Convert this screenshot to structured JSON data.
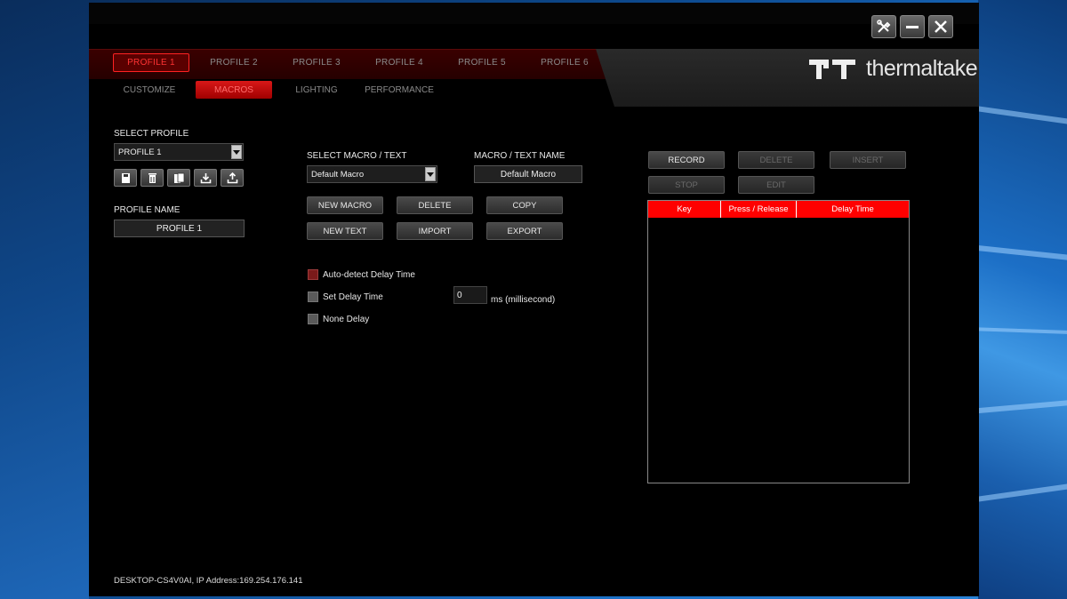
{
  "window": {
    "brand": "thermaltake"
  },
  "profile_tabs": [
    {
      "label": "PROFILE 1",
      "active": true
    },
    {
      "label": "PROFILE 2",
      "active": false
    },
    {
      "label": "PROFILE 3",
      "active": false
    },
    {
      "label": "PROFILE 4",
      "active": false
    },
    {
      "label": "PROFILE 5",
      "active": false
    },
    {
      "label": "PROFILE 6",
      "active": false
    }
  ],
  "sub_tabs": [
    {
      "label": "CUSTOMIZE",
      "active": false
    },
    {
      "label": "MACROS",
      "active": true
    },
    {
      "label": "LIGHTING",
      "active": false
    },
    {
      "label": "PERFORMANCE",
      "active": false
    }
  ],
  "profile_panel": {
    "select_label": "SELECT PROFILE",
    "selected_profile": "PROFILE 1",
    "name_label": "PROFILE NAME",
    "name_value": "PROFILE 1",
    "icons": [
      "save-icon",
      "trash-icon",
      "copy-icon",
      "import-icon",
      "export-icon"
    ]
  },
  "macro_panel": {
    "select_label": "SELECT MACRO / TEXT",
    "selected_macro": "Default Macro",
    "name_label": "MACRO / TEXT NAME",
    "name_value": "Default Macro",
    "buttons": {
      "new_macro": "NEW MACRO",
      "delete": "DELETE",
      "copy": "COPY",
      "new_text": "NEW TEXT",
      "import": "IMPORT",
      "export": "EXPORT"
    },
    "delay_options": {
      "auto": "Auto-detect Delay Time",
      "set": "Set Delay Time",
      "none": "None Delay",
      "value": "0",
      "unit": "ms (millisecond)"
    }
  },
  "record_panel": {
    "buttons": {
      "record": "RECORD",
      "delete": "DELETE",
      "insert": "INSERT",
      "stop": "STOP",
      "edit": "EDIT"
    },
    "columns": [
      "Key",
      "Press / Release",
      "Delay Time"
    ]
  },
  "footer": {
    "status": "DESKTOP-CS4V0AI, IP Address:169.254.176.141"
  },
  "colors": {
    "accent": "#ff0000",
    "active_tab_text": "#ff3333"
  }
}
